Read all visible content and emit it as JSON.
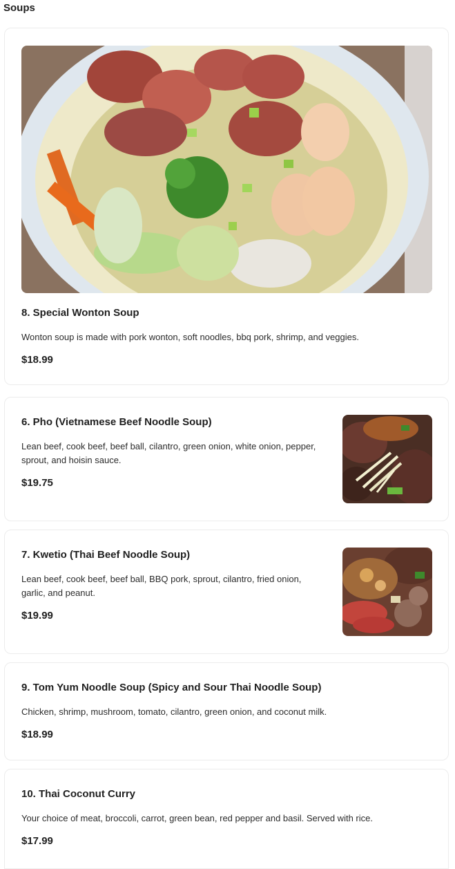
{
  "section": {
    "title": "Soups"
  },
  "items": [
    {
      "name": "8. Special Wonton Soup",
      "description": "Wonton soup is made with pork wonton, soft noodles, bbq pork, shrimp, and veggies.",
      "price": "$18.99",
      "image_icon": "wonton-soup-photo"
    },
    {
      "name": "6. Pho (Vietnamese Beef Noodle Soup)",
      "description": "Lean beef, cook beef, beef ball, cilantro, green onion, white onion, pepper, sprout, and hoisin sauce.",
      "price": "$19.75",
      "image_icon": "pho-photo"
    },
    {
      "name": "7. Kwetio (Thai Beef Noodle Soup)",
      "description": "Lean beef, cook beef, beef ball, BBQ pork, sprout, cilantro, fried onion, garlic, and peanut.",
      "price": "$19.99",
      "image_icon": "kwetio-photo"
    },
    {
      "name": "9. Tom Yum Noodle Soup (Spicy and Sour Thai Noodle Soup)",
      "description": "Chicken, shrimp, mushroom, tomato, cilantro, green onion, and coconut milk.",
      "price": "$18.99"
    },
    {
      "name": "10. Thai Coconut Curry",
      "description": "Your choice of meat, broccoli, carrot, green bean, red pepper and basil. Served with rice.",
      "price": "$17.99"
    }
  ]
}
